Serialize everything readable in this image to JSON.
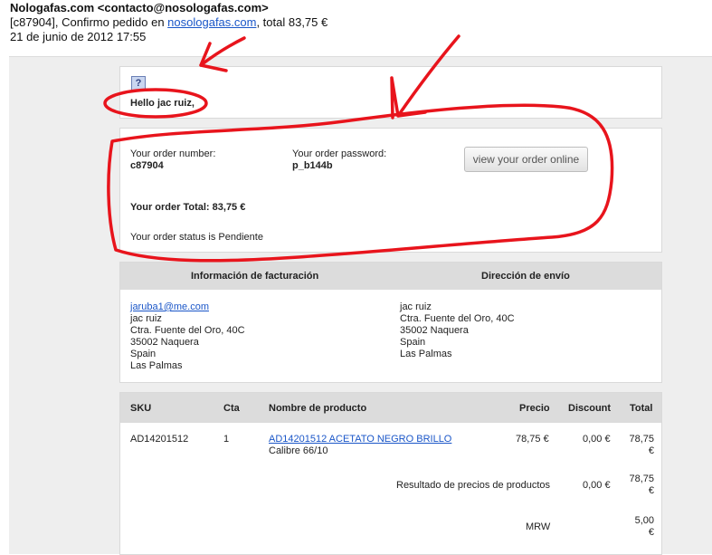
{
  "header": {
    "from": "Nologafas.com <contacto@nosologafas.com>",
    "subject_prefix": "[c87904], Confirmo pedido en ",
    "subject_link": "nosologafas.com",
    "subject_suffix": ", total 83,75 €",
    "date": "21 de junio de 2012 17:55"
  },
  "greeting": "Hello jac ruiz,",
  "order": {
    "number_label": "Your order number:",
    "number": "c87904",
    "password_label": "Your order password:",
    "password": "p_b144b",
    "view_button": "view your order online",
    "total": "Your order Total: 83,75 €",
    "status": "Your order status is Pendiente"
  },
  "billing": {
    "heading": "Información de facturación",
    "email": "jaruba1@me.com",
    "lines": [
      "jac ruiz",
      "Ctra. Fuente del Oro, 40C",
      "35002 Naquera",
      "Spain",
      "Las Palmas"
    ]
  },
  "shipping": {
    "heading": "Dirección de envío",
    "lines": [
      "jac ruiz",
      "Ctra. Fuente del Oro, 40C",
      "35002 Naquera",
      "Spain",
      "Las Palmas"
    ]
  },
  "products": {
    "columns": [
      "SKU",
      "Cta",
      "Nombre de producto",
      "Precio",
      "Discount",
      "Total"
    ],
    "row": {
      "sku": "AD14201512",
      "qty": "1",
      "name": "AD14201512 ACETATO NEGRO BRILLO",
      "variant": "Calibre 66/10",
      "price": "78,75 €",
      "discount": "0,00 €",
      "total": "78,75 €"
    },
    "summary_label": "Resultado de precios de productos",
    "summary_discount": "0,00 €",
    "summary_total": "78,75 €",
    "shipping_label": "MRW",
    "shipping_total": "5,00 €"
  },
  "colors": {
    "link": "#1a56c8",
    "annotation": "#e8141c"
  }
}
